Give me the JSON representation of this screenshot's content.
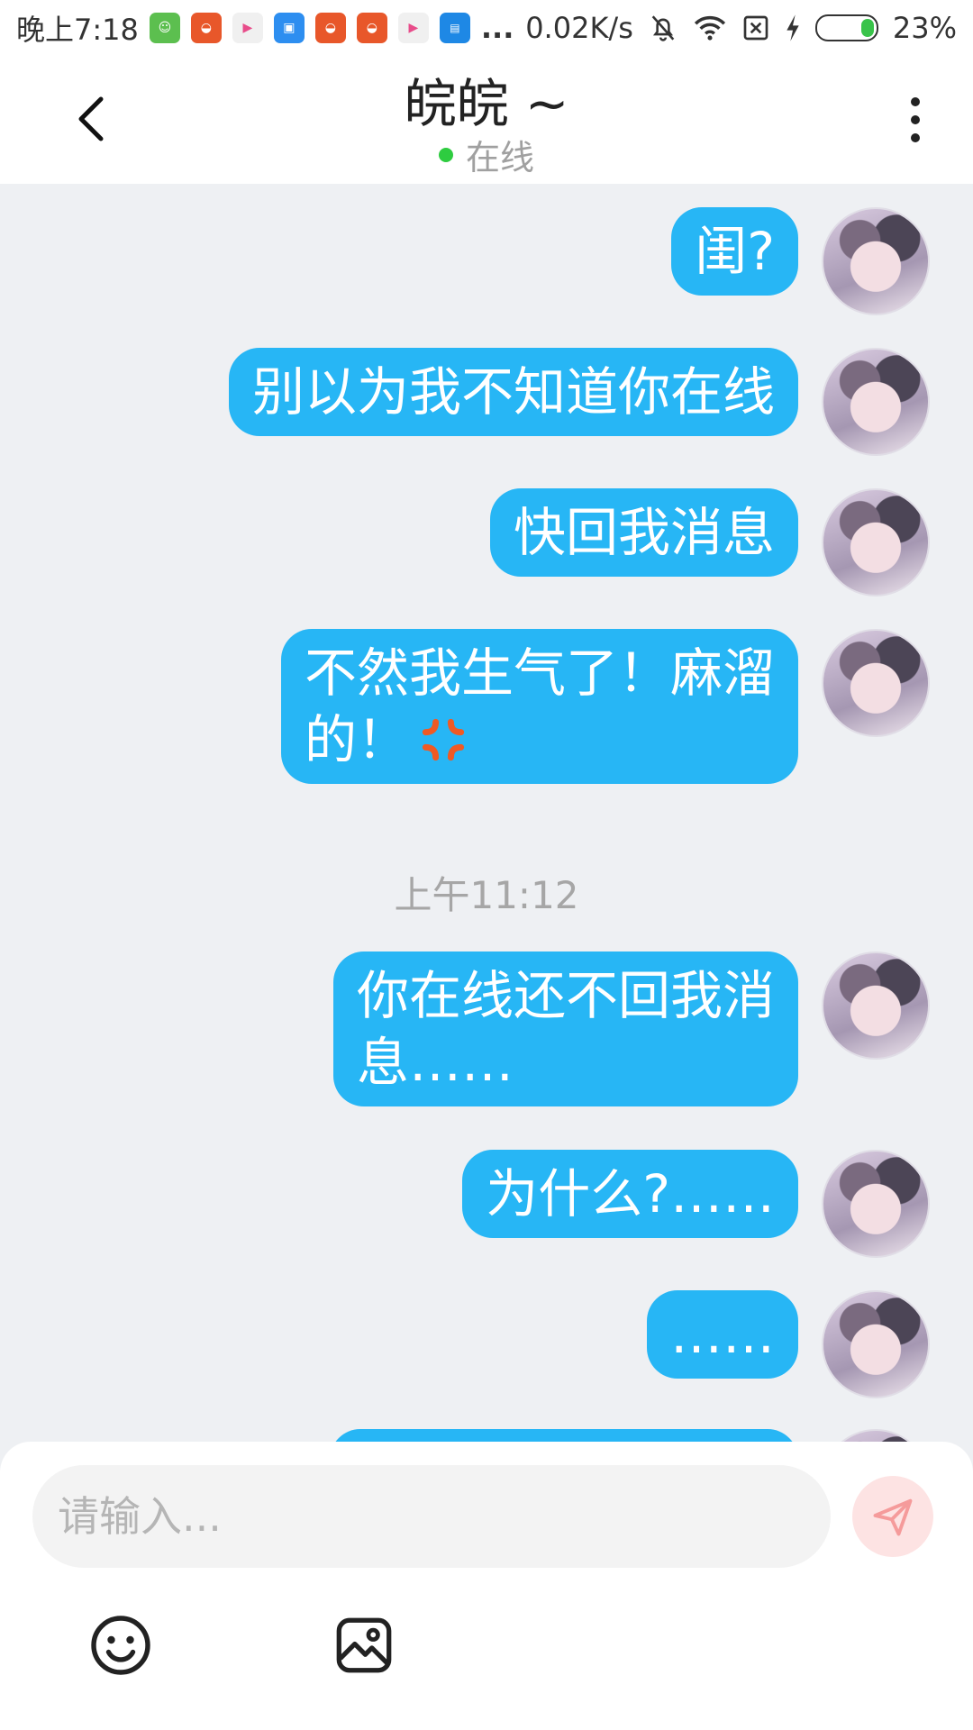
{
  "status_bar": {
    "time": "晚上7:18",
    "more": "...",
    "network_speed": "0.02K/s",
    "battery": "23%",
    "battery_level": 0.23
  },
  "header": {
    "title": "皖皖 ~",
    "status": "在线"
  },
  "messages": [
    {
      "text": "闺?"
    },
    {
      "text": "别以为我不知道你在线"
    },
    {
      "text": "快回我消息"
    },
    {
      "text": "不然我生气了！麻溜\n的！",
      "emoji": "anger-symbol-icon"
    },
    {
      "text": "你在线还不回我消\n息……"
    },
    {
      "text": "为什么?……"
    },
    {
      "text": "……"
    },
    {
      "text": ""
    }
  ],
  "timestamp": "上午11:12",
  "input": {
    "placeholder": "请输入..."
  },
  "colors": {
    "bubble": "#27b6f5",
    "online": "#2ecc40",
    "send_button": "#fde3e3",
    "send_icon": "#f59b9b"
  }
}
